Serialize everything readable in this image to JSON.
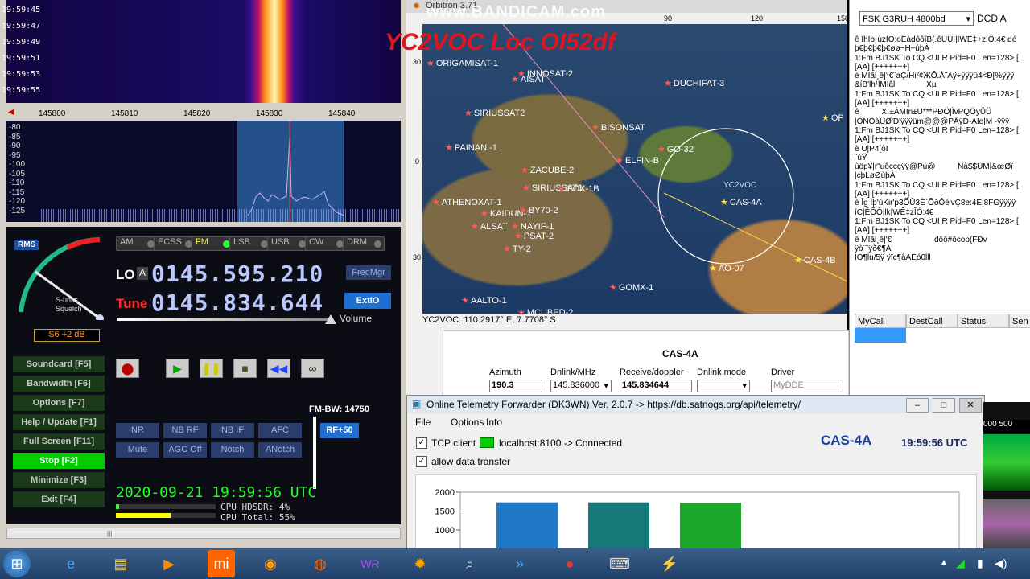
{
  "hdsdr": {
    "waterfall_times": [
      "19:59:45",
      "19:59:47",
      "19:59:49",
      "19:59:51",
      "19:59:53",
      "19:59:55"
    ],
    "freq_scale": [
      "145800",
      "145810",
      "145820",
      "145830",
      "145840"
    ],
    "db_scale": [
      "-80",
      "-85",
      "-90",
      "-95",
      "-100",
      "-105",
      "-110",
      "-115",
      "-120",
      "-125"
    ],
    "rms_label": "RMS",
    "s_units_label": "S-units",
    "squelch_label": "Squelch",
    "s_readout": "S6 +2 dB",
    "modes": [
      {
        "label": "AM",
        "active": false
      },
      {
        "label": "ECSS",
        "active": false
      },
      {
        "label": "FM",
        "active": true
      },
      {
        "label": "LSB",
        "active": false
      },
      {
        "label": "USB",
        "active": false
      },
      {
        "label": "CW",
        "active": false
      },
      {
        "label": "DRM",
        "active": false
      }
    ],
    "lo_label": "LO",
    "lo_a": "A",
    "lo_freq": "0145.595.210",
    "tune_label": "Tune",
    "tune_freq": "0145.834.644",
    "freqmgr": "FreqMgr",
    "extio": "ExtIO",
    "volume": "Volume",
    "left_buttons": [
      {
        "label": "Soundcard [F5]",
        "green": false
      },
      {
        "label": "Bandwidth [F6]",
        "green": false
      },
      {
        "label": "Options [F7]",
        "green": false
      },
      {
        "label": "Help / Update [F1]",
        "green": false
      },
      {
        "label": "Full Screen [F11]",
        "green": false
      },
      {
        "label": "Stop [F2]",
        "green": true
      },
      {
        "label": "Minimize [F3]",
        "green": false
      },
      {
        "label": "Exit [F4]",
        "green": false
      }
    ],
    "fm_bw": "FM-BW: 14750",
    "dsp_row1": [
      "NR",
      "NB RF",
      "NB IF",
      "AFC"
    ],
    "dsp_row2": [
      "Mute",
      "AGC Off",
      "Notch",
      "ANotch"
    ],
    "rf_btn": "RF+50",
    "datetime": "2020-09-21   19:59:56 UTC",
    "cpu_hdsdr": "CPU HDSDR:  4%",
    "cpu_total": "CPU Total: 55%"
  },
  "orbitron": {
    "title": "Orbitron 3.71",
    "top_axis": [
      "90",
      "120",
      "150"
    ],
    "left_axis": [
      "30",
      "0",
      "30"
    ],
    "satellites": [
      {
        "name": "ORIGAMISAT-1",
        "y": false
      },
      {
        "name": "AISAT",
        "y": false
      },
      {
        "name": "INNOSAT-2",
        "y": false
      },
      {
        "name": "DUCHIFAT-3",
        "y": false
      },
      {
        "name": "SIRIUSSAT2",
        "y": false
      },
      {
        "name": "BISONSAT",
        "y": false
      },
      {
        "name": "PAINANI-1",
        "y": false
      },
      {
        "name": "GO-32",
        "y": false
      },
      {
        "name": "ELFIN-B",
        "y": false
      },
      {
        "name": "ZACUBE-2",
        "y": false
      },
      {
        "name": "SIRIUSSAT1",
        "y": false
      },
      {
        "name": "FOX-1B",
        "y": false
      },
      {
        "name": "ATHENOXAT-1",
        "y": false
      },
      {
        "name": "KAIDUN-1",
        "y": false
      },
      {
        "name": "BY70-2",
        "y": false
      },
      {
        "name": "ALSAT",
        "y": false
      },
      {
        "name": "NAYIF-1",
        "y": false
      },
      {
        "name": "PSAT-2",
        "y": false
      },
      {
        "name": "TY-2",
        "y": false
      },
      {
        "name": "GOMX-1",
        "y": false
      },
      {
        "name": "AALTO-1",
        "y": false
      },
      {
        "name": "MCUBED-2",
        "y": false
      },
      {
        "name": "CAS-4A",
        "y": true
      },
      {
        "name": "AO-07",
        "y": true
      },
      {
        "name": "CAS-4B",
        "y": true
      },
      {
        "name": "OP",
        "y": true
      }
    ],
    "observer": "YC2VOC",
    "status": "YC2VOC: 110.2917° E, 7.7708° S",
    "selected_sat": "CAS-4A",
    "azimuth_label": "Azimuth",
    "azimuth": "190.3",
    "dnlink_label": "Dnlink/MHz",
    "dnlink": "145.836000",
    "recv_label": "Receive/doppler",
    "recv": "145.834644",
    "mode_label": "Dnlink mode",
    "mode": "",
    "driver_label": "Driver",
    "driver": "MyDDE"
  },
  "rpanel": {
    "modem": "FSK G3RUH 4800bd",
    "dcd": "DCD A",
    "terminal": "ê ÎhÌþ¸ùzÌÕ:oÊàdôôîB(.êÙÙI|ÌWÊ‡+zÎÓ:4€ dé\nþ€þ€þ€þ€øø~H÷úþÀ\n1:Fm BJ1SK To CQ <UI R Pid=F0 Len=128> [\n[AA] [+++++++]\nè MIâl¸ê|°€¨aÇ/Hi²¢ЖÕ.À˜Aÿ÷ÿÿÿû4<Ð[%ÿÿÿ\n&íB'lh¹lMIâl              Xµ\n1:Fm BJ1SK To CQ <UI R Pid=F0 Len=128> [\n[AA] [+++++++]\nê          X¡±ÁMIn±U***PÐÖ|ÌvPQÖÿÜÜ\n|ÕÑÔàÜØ'Ð'ÿÿÿüm@@@PÄÿÐ-ÀIe|M -ÿÿÿ\n1:Fm BJ1SK To CQ <UI R Pid=F0 Len=128> [\n[AA] [+++++++]\nè U|P4[òI\n¨ùŸ\nùöp¥|r\"uôccçÿÿ@Pú@          Nà$$ÜM|&œØï\n|cþLøØùþÀ\n1:Fm BJ1SK To CQ <UI R Pid=F0 Len=128> [\n[AA] [+++++++]\nè Îg Ìþ'ùKir'p3ÕÛ3È`ÕðÔé'vÇ8e:4E|8FGÿÿÿÿ\níC|ÊÕÔ|lk|WÊ‡zÎÓ:4€\n1:Fm BJ1SK To CQ <UI R Pid=F0 Len=128> [\n[AA] [+++++++]\nê MIâl¸ê|'€                   dôô#ôcop(FÐv\nÿò¨¨ÿð€¶À\nÌÕ¶lu/5ÿ ÿïc¶âÀÈó0lll",
    "columns": [
      "MyCall",
      "DestCall",
      "Status",
      "Sen"
    ]
  },
  "telemetry": {
    "title": "Online Telemetry Forwarder (DK3WN) Ver. 2.0.7 -> https://db.satnogs.org/api/telemetry/",
    "menu": [
      "File",
      "Options",
      "Info"
    ],
    "tcp_label": "TCP client",
    "tcp_status": "localhost:8100 -> Connected",
    "allow_label": "allow data transfer",
    "sat": "CAS-4A",
    "time": "19:59:56 UTC"
  },
  "chart_data": {
    "type": "bar",
    "yticks": [
      2000,
      1500,
      1000
    ],
    "values": [
      1730,
      1730,
      1720
    ],
    "colors": [
      "#1f78c8",
      "#167a7a",
      "#1aa72a"
    ]
  },
  "overlay": {
    "bandicam": "www.BANDICAM.com",
    "callsign": "YC2VOC Loc OI52df"
  },
  "taskbar": {
    "icons": [
      "start-icon",
      "ie-icon",
      "explorer-icon",
      "media-player-icon",
      "mi-icon",
      "uc-browser-icon",
      "firefox-icon",
      "winrar-icon",
      "orbitron-icon",
      "magnifier-icon",
      "teamviewer-icon",
      "record-icon",
      "keyboard-icon",
      "satellite-tool-icon"
    ]
  },
  "colors": {
    "accent_blue": "#1e6fd0",
    "green": "#00cc00",
    "callsign_red": "#e0151d"
  }
}
